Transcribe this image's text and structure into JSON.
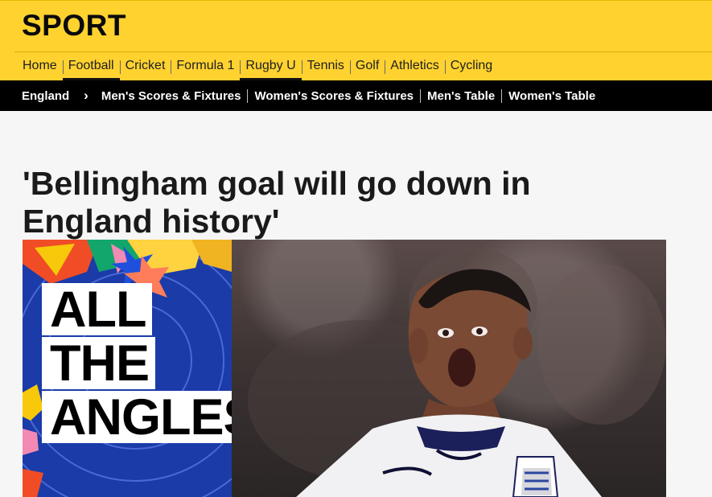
{
  "brand": "SPORT",
  "nav": {
    "items": [
      {
        "label": "Home",
        "active": false
      },
      {
        "label": "Football",
        "active": true
      },
      {
        "label": "Cricket",
        "active": false
      },
      {
        "label": "Formula 1",
        "active": false
      },
      {
        "label": "Rugby U",
        "active": true
      },
      {
        "label": "Tennis",
        "active": false
      },
      {
        "label": "Golf",
        "active": false
      },
      {
        "label": "Athletics",
        "active": false
      },
      {
        "label": "Cycling",
        "active": false
      }
    ]
  },
  "subnav": {
    "section": "England",
    "items": [
      "Men's Scores & Fixtures",
      "Women's Scores & Fixtures",
      "Men's Table",
      "Women's Table"
    ]
  },
  "article": {
    "headline": "'Bellingham goal will go down in England history'",
    "image_text": {
      "line1": "ALL",
      "line2": "THE",
      "line3": "ANGLES"
    }
  },
  "colors": {
    "brand_yellow": "#ffd230",
    "subnav_black": "#000000",
    "hero_blue": "#1a3ba8"
  }
}
